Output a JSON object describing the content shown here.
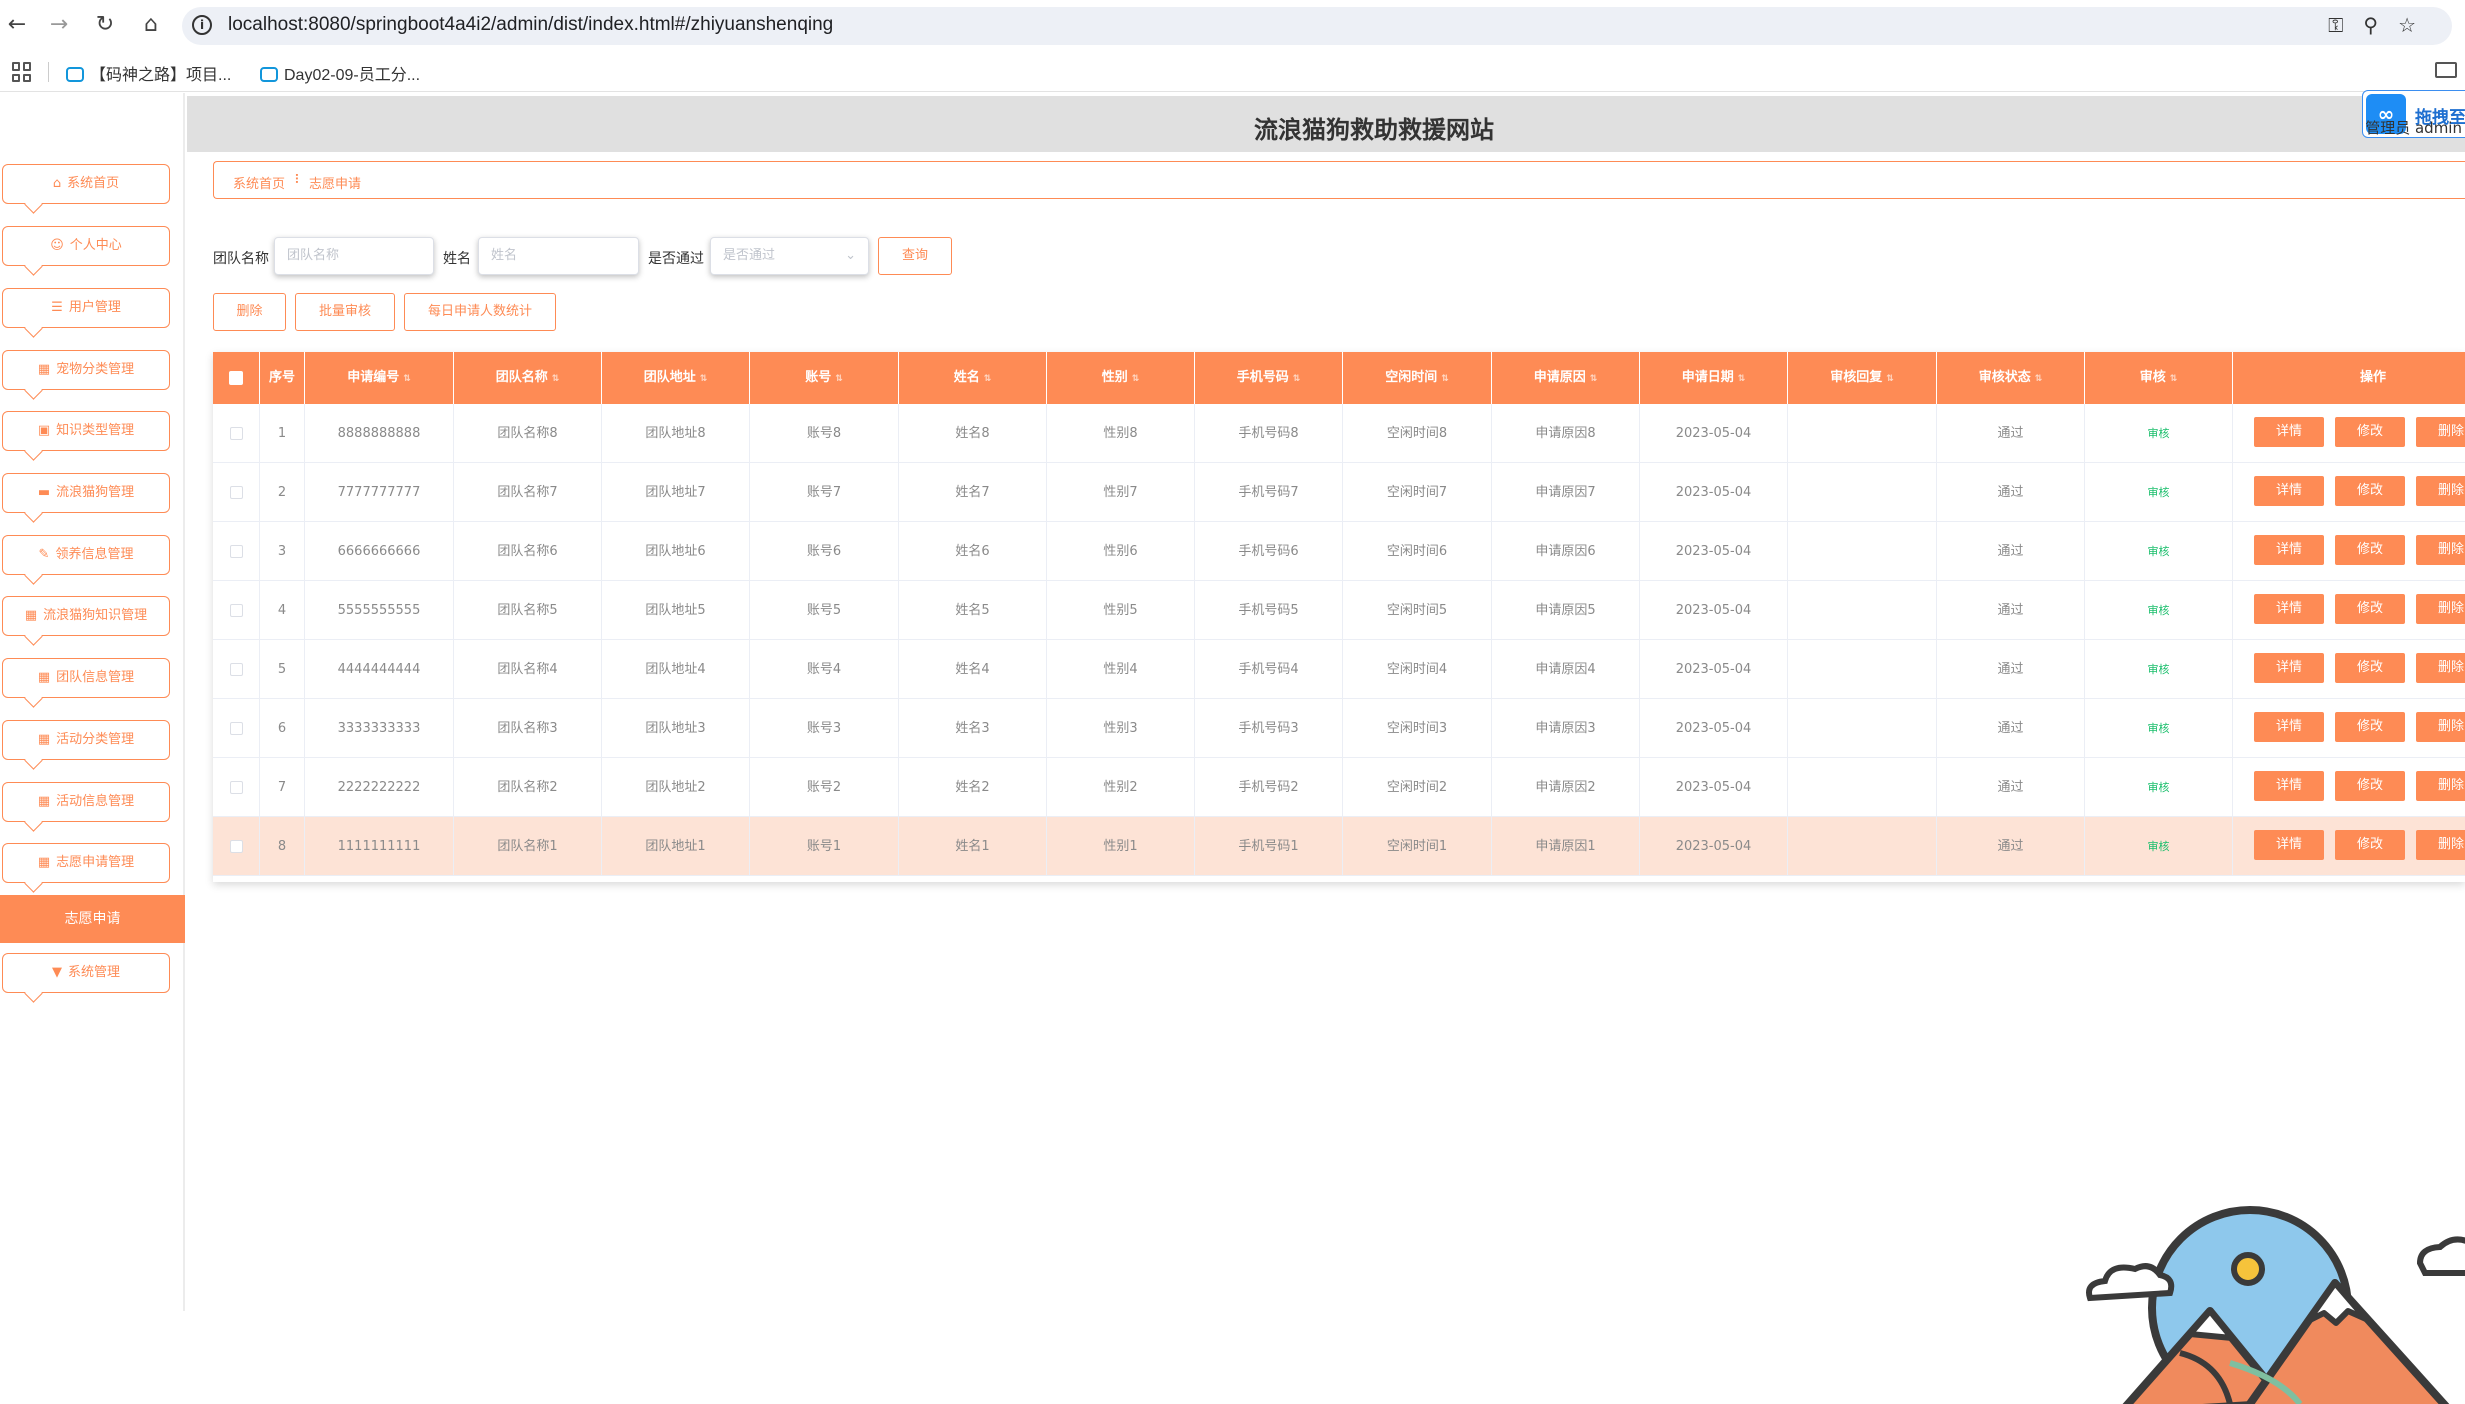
{
  "browser": {
    "url": "localhost:8080/springboot4a4i2/admin/dist/index.html#/zhiyuanshenqing",
    "bookmarks": [
      "【码神之路】项目...",
      "Day02-09-员工分..."
    ]
  },
  "header": {
    "site_title": "流浪猫狗救助救援网站",
    "upload_label": "拖拽至此上传",
    "admin_label": "管理员 admin"
  },
  "sidebar": {
    "items": [
      {
        "label": "系统首页",
        "icon": "⌂"
      },
      {
        "label": "个人中心",
        "icon": "☺"
      },
      {
        "label": "用户管理",
        "icon": "☰"
      },
      {
        "label": "宠物分类管理",
        "icon": "▦"
      },
      {
        "label": "知识类型管理",
        "icon": "▣"
      },
      {
        "label": "流浪猫狗管理",
        "icon": "▬"
      },
      {
        "label": "领养信息管理",
        "icon": "✎"
      },
      {
        "label": "流浪猫狗知识管理",
        "icon": "▦"
      },
      {
        "label": "团队信息管理",
        "icon": "▦"
      },
      {
        "label": "活动分类管理",
        "icon": "▦"
      },
      {
        "label": "活动信息管理",
        "icon": "▦"
      },
      {
        "label": "志愿申请管理",
        "icon": "▦"
      },
      {
        "label": "系统管理",
        "icon": "▼"
      }
    ],
    "sub_item": "志愿申请"
  },
  "breadcrumb": {
    "home": "系统首页",
    "separator": "⠇",
    "current": "志愿申请"
  },
  "search": {
    "team_label": "团队名称",
    "team_placeholder": "团队名称",
    "name_label": "姓名",
    "name_placeholder": "姓名",
    "pass_label": "是否通过",
    "pass_placeholder": "是否通过",
    "query_button": "查询"
  },
  "actions": {
    "delete": "删除",
    "batch_audit": "批量审核",
    "daily_stats": "每日申请人数统计"
  },
  "table": {
    "columns": [
      "序号",
      "申请编号",
      "团队名称",
      "团队地址",
      "账号",
      "姓名",
      "性别",
      "手机号码",
      "空闲时间",
      "申请原因",
      "申请日期",
      "审核回复",
      "审核状态",
      "审核",
      "操作"
    ],
    "rows": [
      {
        "idx": "1",
        "no": "8888888888",
        "team": "团队名称8",
        "addr": "团队地址8",
        "acct": "账号8",
        "name": "姓名8",
        "sex": "性别8",
        "phone": "手机号码8",
        "free": "空闲时间8",
        "reason": "申请原因8",
        "date": "2023-05-04",
        "reply": "",
        "status": "通过",
        "audit": "审核"
      },
      {
        "idx": "2",
        "no": "7777777777",
        "team": "团队名称7",
        "addr": "团队地址7",
        "acct": "账号7",
        "name": "姓名7",
        "sex": "性别7",
        "phone": "手机号码7",
        "free": "空闲时间7",
        "reason": "申请原因7",
        "date": "2023-05-04",
        "reply": "",
        "status": "通过",
        "audit": "审核"
      },
      {
        "idx": "3",
        "no": "6666666666",
        "team": "团队名称6",
        "addr": "团队地址6",
        "acct": "账号6",
        "name": "姓名6",
        "sex": "性别6",
        "phone": "手机号码6",
        "free": "空闲时间6",
        "reason": "申请原因6",
        "date": "2023-05-04",
        "reply": "",
        "status": "通过",
        "audit": "审核"
      },
      {
        "idx": "4",
        "no": "5555555555",
        "team": "团队名称5",
        "addr": "团队地址5",
        "acct": "账号5",
        "name": "姓名5",
        "sex": "性别5",
        "phone": "手机号码5",
        "free": "空闲时间5",
        "reason": "申请原因5",
        "date": "2023-05-04",
        "reply": "",
        "status": "通过",
        "audit": "审核"
      },
      {
        "idx": "5",
        "no": "4444444444",
        "team": "团队名称4",
        "addr": "团队地址4",
        "acct": "账号4",
        "name": "姓名4",
        "sex": "性别4",
        "phone": "手机号码4",
        "free": "空闲时间4",
        "reason": "申请原因4",
        "date": "2023-05-04",
        "reply": "",
        "status": "通过",
        "audit": "审核"
      },
      {
        "idx": "6",
        "no": "3333333333",
        "team": "团队名称3",
        "addr": "团队地址3",
        "acct": "账号3",
        "name": "姓名3",
        "sex": "性别3",
        "phone": "手机号码3",
        "free": "空闲时间3",
        "reason": "申请原因3",
        "date": "2023-05-04",
        "reply": "",
        "status": "通过",
        "audit": "审核"
      },
      {
        "idx": "7",
        "no": "2222222222",
        "team": "团队名称2",
        "addr": "团队地址2",
        "acct": "账号2",
        "name": "姓名2",
        "sex": "性别2",
        "phone": "手机号码2",
        "free": "空闲时间2",
        "reason": "申请原因2",
        "date": "2023-05-04",
        "reply": "",
        "status": "通过",
        "audit": "审核"
      },
      {
        "idx": "8",
        "no": "1111111111",
        "team": "团队名称1",
        "addr": "团队地址1",
        "acct": "账号1",
        "name": "姓名1",
        "sex": "性别1",
        "phone": "手机号码1",
        "free": "空闲时间1",
        "reason": "申请原因1",
        "date": "2023-05-04",
        "reply": "",
        "status": "通过",
        "audit": "审核"
      }
    ],
    "row_actions": {
      "detail": "详情",
      "edit": "修改",
      "delete": "删除"
    }
  },
  "colors": {
    "accent": "#fe8b55",
    "highlight_row": "#fde3d6",
    "audit_link": "#19be6b",
    "upload_blue": "#1e8df5"
  }
}
